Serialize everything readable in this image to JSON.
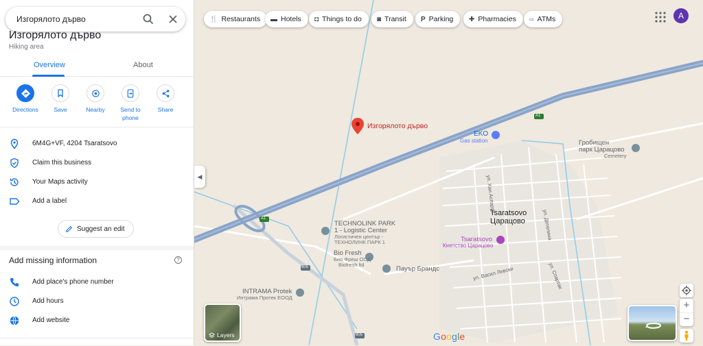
{
  "search": {
    "value": "Изгорялото дърво"
  },
  "place": {
    "title": "Изгорялото дърво",
    "category": "Hiking area"
  },
  "tabs": [
    {
      "label": "Overview"
    },
    {
      "label": "About"
    }
  ],
  "actions": [
    {
      "label": "Directions",
      "icon": "directions-icon"
    },
    {
      "label": "Save",
      "icon": "bookmark-icon"
    },
    {
      "label": "Nearby",
      "icon": "nearby-icon"
    },
    {
      "label": "Send to phone",
      "icon": "send-to-phone-icon"
    },
    {
      "label": "Share",
      "icon": "share-icon"
    }
  ],
  "info_rows": [
    {
      "text": "6M4G+VF, 4204 Tsaratsovo",
      "icon": "location-pin-icon"
    },
    {
      "text": "Claim this business",
      "icon": "verified-shield-icon"
    },
    {
      "text": "Your Maps activity",
      "icon": "history-icon"
    },
    {
      "text": "Add a label",
      "icon": "label-icon"
    }
  ],
  "suggest_edit": "Suggest an edit",
  "missing": {
    "heading": "Add missing information",
    "rows": [
      {
        "text": "Add place's phone number",
        "icon": "phone-icon"
      },
      {
        "text": "Add hours",
        "icon": "clock-icon"
      },
      {
        "text": "Add website",
        "icon": "globe-icon"
      }
    ]
  },
  "chips": [
    {
      "label": "Restaurants",
      "icon": "restaurant-icon"
    },
    {
      "label": "Hotels",
      "icon": "hotel-icon"
    },
    {
      "label": "Things to do",
      "icon": "camera-icon"
    },
    {
      "label": "Transit",
      "icon": "transit-icon"
    },
    {
      "label": "Parking",
      "icon": "parking-icon"
    },
    {
      "label": "Pharmacies",
      "icon": "pharmacy-icon"
    },
    {
      "label": "ATMs",
      "icon": "atm-icon"
    }
  ],
  "account": {
    "initial": "A"
  },
  "layers_label": "Layers",
  "map_labels": {
    "selected_place": "Изгорялото дърво",
    "eko": "EKO",
    "gas_station": "Gas station",
    "cemetery_line1": "Гробищен",
    "cemetery_line2": "парк Царацово",
    "cemetery_sub": "Cemetery",
    "town_latin": "Tsaratsovo",
    "town_cyrillic": "Царацово",
    "townhall": "Tsaratsovo",
    "townhall_sub": "Кметство Царацово",
    "technolink_1": "TECHNOLINK PARK",
    "technolink_2": "1 - Logistic Center",
    "technolink_3": "Логистичен център -",
    "technolink_4": "ТЕХНОЛИНК ПАРК 1",
    "biofresh": "Bio Fresh",
    "biofresh_2": "Био Фреш ООД",
    "biofresh_3": "Biofresh ltd",
    "power": "Пауър Брандс",
    "intrama": "INTRAMA Protek",
    "intrama_2": "Интрама Протек ЕООД",
    "street_han": "ул. Хан Аспарух",
    "street_deteliya": "ул. Детелина",
    "street_levski": "ул. Васил Левски",
    "street_spartak": "ул. Спартак",
    "road_a1": "A1",
    "road_a1b": "A1",
    "road_805": "805",
    "road_805b": "805"
  },
  "colors": {
    "accent": "#1a73e8",
    "marker": "#ea4335",
    "highway": "#8aa4c8",
    "road": "#ffffff",
    "water": "#9fd3f0"
  }
}
